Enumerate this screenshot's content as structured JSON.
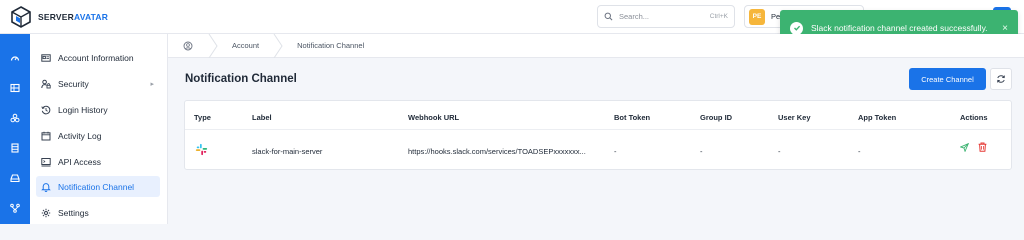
{
  "brand": {
    "name_part1": "SERVER",
    "name_part2": "AVATAR",
    "accent": "#1a73e8"
  },
  "search": {
    "placeholder": "Search...",
    "shortcut": "Ctrl+K"
  },
  "user": {
    "initials": "PE",
    "name": "Pe"
  },
  "toast": {
    "message": "Slack notification channel created successfully.",
    "close": "×",
    "color": "#3cb371"
  },
  "rail_icons": [
    "dashboard-icon",
    "servers-icon",
    "applications-icon",
    "database-icon",
    "storage-icon",
    "integrations-icon"
  ],
  "sidebar": {
    "items": [
      {
        "label": "Account Information",
        "icon": "id-card-icon"
      },
      {
        "label": "Security",
        "icon": "user-lock-icon",
        "chevron": "▸"
      },
      {
        "label": "Login History",
        "icon": "history-icon"
      },
      {
        "label": "Activity Log",
        "icon": "calendar-icon"
      },
      {
        "label": "API Access",
        "icon": "terminal-icon"
      },
      {
        "label": "Notification Channel",
        "icon": "bell-icon",
        "active": true
      },
      {
        "label": "Settings",
        "icon": "gear-icon"
      }
    ]
  },
  "breadcrumb": {
    "items": [
      "Account",
      "Notification Channel"
    ]
  },
  "page": {
    "title": "Notification Channel",
    "create_button": "Create Channel"
  },
  "table": {
    "headers": [
      "Type",
      "Label",
      "Webhook URL",
      "Bot Token",
      "Group ID",
      "User Key",
      "App Token",
      "Actions"
    ],
    "rows": [
      {
        "type_icon": "slack-icon",
        "label": "slack-for-main-server",
        "webhook": "https://hooks.slack.com/services/TOADSEPxxxxxxx...",
        "bot_token": "-",
        "group_id": "-",
        "user_key": "-",
        "app_token": "-"
      }
    ]
  }
}
